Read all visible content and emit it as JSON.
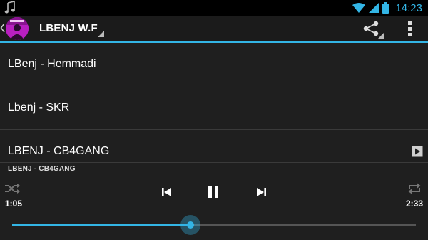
{
  "status_bar": {
    "time": "14:23",
    "icons": [
      "music-note-icon",
      "wifi-icon",
      "signal-icon",
      "battery-icon"
    ],
    "accent_color": "#33b5e5"
  },
  "action_bar": {
    "title": "LBENJ W.F",
    "avatar_icon": "album-art-icon",
    "actions": [
      "share-icon",
      "overflow-menu-icon"
    ]
  },
  "tracks": [
    {
      "title": "LBenj - Hemmadi",
      "playing": false
    },
    {
      "title": "Lbenj - SKR",
      "playing": false
    },
    {
      "title": "LBENJ - CB4GANG",
      "playing": true
    }
  ],
  "player": {
    "now_playing": "LBENJ - CB4GANG",
    "elapsed": "1:05",
    "total": "2:33",
    "progress": 0.4412,
    "controls": [
      "shuffle-icon",
      "previous-icon",
      "pause-icon",
      "next-icon",
      "repeat-icon"
    ]
  }
}
